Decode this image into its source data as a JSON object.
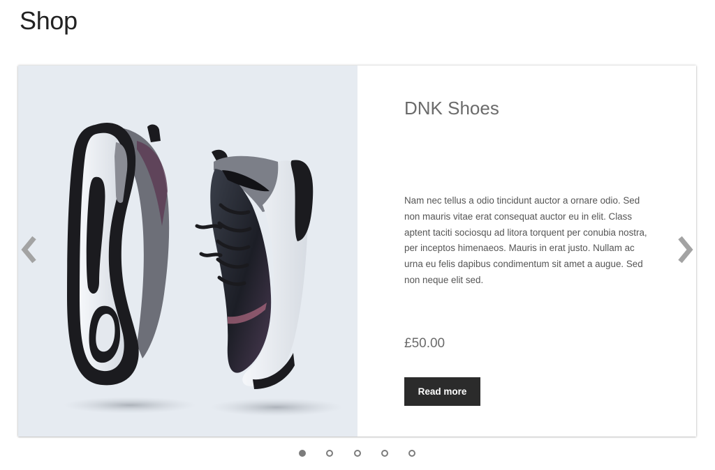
{
  "page": {
    "title": "Shop"
  },
  "slider": {
    "prev_icon": "chevron-left-icon",
    "next_icon": "chevron-right-icon",
    "arrow_color": "#a3a3a3",
    "active_slide": 1,
    "slide_count": 5,
    "slide": {
      "image_subject": "product-image-shoes",
      "title": "DNK Shoes",
      "description": "Nam nec tellus a odio tincidunt auctor a ornare odio. Sed non mauris vitae erat consequat auctor eu in elit. Class aptent taciti sociosqu ad litora torquent per conubia nostra, per inceptos himenaeos. Mauris in erat justo. Nullam ac urna eu felis dapibus condimentum sit amet a augue. Sed non neque elit sed.",
      "price": "£50.00",
      "button_label": "Read more"
    }
  },
  "colors": {
    "image_background": "#e6ebf1",
    "button_background": "#2b2b2b",
    "dot_color": "#7c7c7c"
  }
}
